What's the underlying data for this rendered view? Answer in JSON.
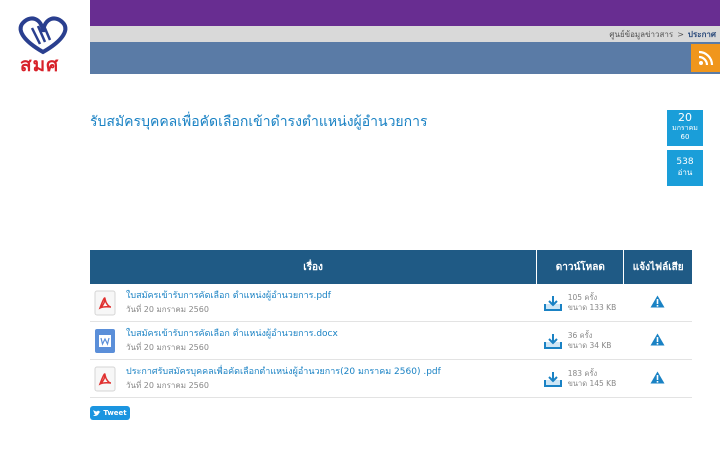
{
  "brand": {
    "logo_text": "สมศ"
  },
  "breadcrumb": {
    "parent": "ศูนย์ข้อมูลข่าวสาร",
    "separator": ">",
    "current": "ประกาศ"
  },
  "title": "รับสมัครบุคคลเพื่อคัดเลือกเข้าดำรงตำแหน่งผู้อำนวยการ",
  "date": {
    "day": "20",
    "month": "มกราคม",
    "year": "60"
  },
  "reads": {
    "count": "538",
    "label": "อ่าน"
  },
  "table": {
    "headers": {
      "name": "เรื่อง",
      "download": "ดาวน์โหลด",
      "report": "แจ้งไฟล์เสีย"
    },
    "rows": [
      {
        "type": "pdf",
        "name": "ใบสมัครเข้ารับการคัดเลือก ตำแหน่งผู้อำนวยการ.pdf",
        "date": "วันที่ 20 มกราคม 2560",
        "downloads": "105 ครั้ง",
        "size": "ขนาด 133 KB"
      },
      {
        "type": "docx",
        "name": "ใบสมัครเข้ารับการคัดเลือก ตำแหน่งผู้อำนวยการ.docx",
        "date": "วันที่ 20 มกราคม 2560",
        "downloads": "36 ครั้ง",
        "size": "ขนาด 34 KB"
      },
      {
        "type": "pdf",
        "name": "ประกาศรับสมัครบุคคลเพื่อคัดเลือกตำแหน่งผู้อำนวยการ(20 มกราคม 2560) .pdf",
        "date": "วันที่ 20 มกราคม 2560",
        "downloads": "183 ครั้ง",
        "size": "ขนาด 145 KB"
      }
    ]
  },
  "tweet": {
    "label": "Tweet"
  },
  "colors": {
    "purple": "#682d91",
    "blue_band": "#5a7ba6",
    "rss": "#f0961c",
    "title": "#1a82c4",
    "header": "#1f5a85",
    "badge": "#1a9ed9"
  },
  "icons": {
    "rss": "rss-icon",
    "pdf": "pdf-file-icon",
    "docx": "word-file-icon",
    "download": "download-tray-icon",
    "warning": "warning-triangle-icon",
    "twitter": "twitter-bird-icon"
  }
}
